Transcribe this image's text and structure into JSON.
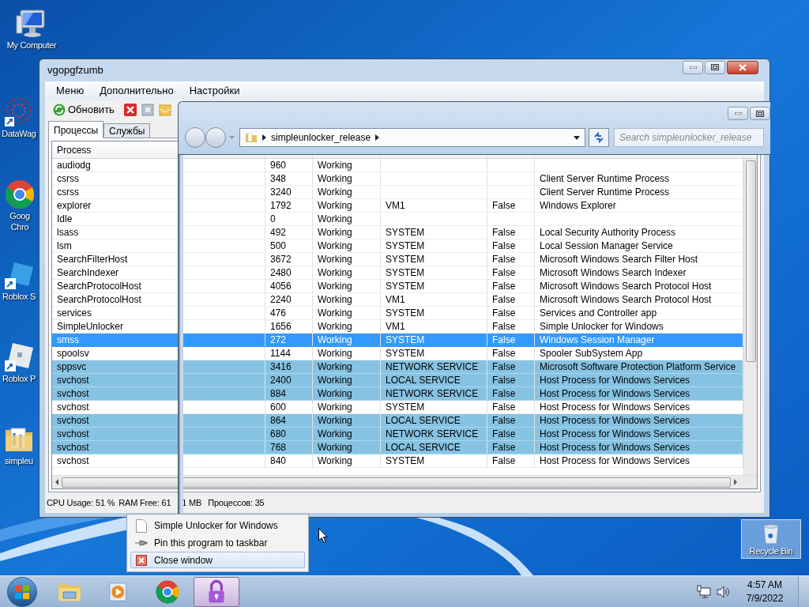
{
  "desktop_icons": [
    {
      "kind": "computer",
      "lines": [
        "My Computer"
      ],
      "selected": false
    },
    {
      "kind": "network",
      "lines": [
        "DataWag"
      ],
      "selected": false
    },
    {
      "kind": "chrome",
      "lines": [
        "Goog",
        "Chro"
      ],
      "selected": false
    },
    {
      "kind": "studio",
      "lines": [
        "Roblox S"
      ],
      "selected": false
    },
    {
      "kind": "roblox",
      "lines": [
        "Roblox P"
      ],
      "selected": false
    },
    {
      "kind": "folder",
      "lines": [
        "simpleu"
      ],
      "selected": false
    }
  ],
  "recycle_bin": {
    "kind": "bin",
    "lines": [
      "Recycle Bin"
    ],
    "selected": true
  },
  "main_window": {
    "title": "vgopgfzumb",
    "menu": [
      "Меню",
      "Дополнительно",
      "Настройки"
    ],
    "toolbar": {
      "refresh": "Обновить"
    },
    "tabs": [
      {
        "label": "Процессы",
        "selected": true
      },
      {
        "label": "Службы",
        "selected": false
      }
    ],
    "table": {
      "columns": [
        "Process"
      ],
      "rows": [
        {
          "process": "audiodg",
          "id": "960",
          "status": "Working",
          "selected": false,
          "highlighted": false
        },
        {
          "process": "csrss",
          "id": "348",
          "status": "Working",
          "description": "Client Server Runtime Process",
          "selected": false,
          "highlighted": false
        },
        {
          "process": "csrss",
          "id": "3240",
          "status": "Working",
          "description": "Client Server Runtime Process",
          "selected": false,
          "highlighted": false
        },
        {
          "process": "explorer",
          "id": "1792",
          "status": "Working",
          "username": "VM1",
          "critical": "False",
          "description": "Windows Explorer",
          "selected": false,
          "highlighted": false
        },
        {
          "process": "Idle",
          "id": "0",
          "status": "Working",
          "selected": false,
          "highlighted": false
        },
        {
          "process": "lsass",
          "id": "492",
          "status": "Working",
          "username": "SYSTEM",
          "critical": "False",
          "description": "Local Security Authority Process",
          "selected": false,
          "highlighted": false
        },
        {
          "process": "lsm",
          "id": "500",
          "status": "Working",
          "username": "SYSTEM",
          "critical": "False",
          "description": "Local Session Manager Service",
          "selected": false,
          "highlighted": false
        },
        {
          "process": "SearchFilterHost",
          "id": "3672",
          "status": "Working",
          "username": "SYSTEM",
          "critical": "False",
          "description": "Microsoft Windows Search Filter Host",
          "selected": false,
          "highlighted": false
        },
        {
          "process": "SearchIndexer",
          "id": "2480",
          "status": "Working",
          "username": "SYSTEM",
          "critical": "False",
          "description": "Microsoft Windows Search Indexer",
          "selected": false,
          "highlighted": false
        },
        {
          "process": "SearchProtocolHost",
          "id": "4056",
          "status": "Working",
          "username": "SYSTEM",
          "critical": "False",
          "description": "Microsoft Windows Search Protocol Host",
          "selected": false,
          "highlighted": false
        },
        {
          "process": "SearchProtocolHost",
          "id": "2240",
          "status": "Working",
          "username": "VM1",
          "critical": "False",
          "description": "Microsoft Windows Search Protocol Host",
          "selected": false,
          "highlighted": false
        },
        {
          "process": "services",
          "id": "476",
          "status": "Working",
          "username": "SYSTEM",
          "critical": "False",
          "description": "Services and Controller app",
          "selected": false,
          "highlighted": false
        },
        {
          "process": "SimpleUnlocker",
          "id": "1656",
          "status": "Working",
          "username": "VM1",
          "critical": "False",
          "description": "Simple Unlocker for Windows",
          "selected": false,
          "highlighted": false
        },
        {
          "process": "smss",
          "id": "272",
          "status": "Working",
          "username": "SYSTEM",
          "critical": "False",
          "description": "Windows Session Manager",
          "selected": true,
          "highlighted": false
        },
        {
          "process": "spoolsv",
          "id": "1144",
          "status": "Working",
          "username": "SYSTEM",
          "critical": "False",
          "description": "Spooler SubSystem App",
          "selected": false,
          "highlighted": false
        },
        {
          "process": "sppsvc",
          "id": "3416",
          "status": "Working",
          "username": "NETWORK SERVICE",
          "critical": "False",
          "description": "Microsoft Software Protection Platform Service",
          "selected": false,
          "highlighted": true
        },
        {
          "process": "svchost",
          "id": "2400",
          "status": "Working",
          "username": "LOCAL SERVICE",
          "critical": "False",
          "description": "Host Process for Windows Services",
          "selected": false,
          "highlighted": true
        },
        {
          "process": "svchost",
          "id": "884",
          "status": "Working",
          "username": "NETWORK SERVICE",
          "critical": "False",
          "description": "Host Process for Windows Services",
          "selected": false,
          "highlighted": true
        },
        {
          "process": "svchost",
          "id": "600",
          "status": "Working",
          "username": "SYSTEM",
          "critical": "False",
          "description": "Host Process for Windows Services",
          "selected": false,
          "highlighted": false
        },
        {
          "process": "svchost",
          "id": "864",
          "status": "Working",
          "username": "LOCAL SERVICE",
          "critical": "False",
          "description": "Host Process for Windows Services",
          "selected": false,
          "highlighted": true
        },
        {
          "process": "svchost",
          "id": "680",
          "status": "Working",
          "username": "NETWORK SERVICE",
          "critical": "False",
          "description": "Host Process for Windows Services",
          "selected": false,
          "highlighted": true
        },
        {
          "process": "svchost",
          "id": "768",
          "status": "Working",
          "username": "LOCAL SERVICE",
          "critical": "False",
          "description": "Host Process for Windows Services",
          "selected": false,
          "highlighted": true
        },
        {
          "process": "svchost",
          "id": "840",
          "status": "Working",
          "username": "SYSTEM",
          "critical": "False",
          "description": "Host Process for Windows Services",
          "selected": false,
          "highlighted": false
        }
      ]
    },
    "status_bar": {
      "cpu": "CPU Usage: 51 %",
      "ram": "RAM Free: 61",
      "ram_rest": "1 MB",
      "count": "Процессов: 35"
    }
  },
  "explorer_window": {
    "address": "simpleunlocker_release",
    "search": {
      "placeholder": "Search simpleunlocker_release"
    }
  },
  "jump_list": [
    {
      "kind": "document",
      "label": "Simple Unlocker for Windows",
      "selected": false
    },
    {
      "kind": "pin",
      "label": "Pin this program to taskbar",
      "selected": false
    },
    {
      "kind": "close",
      "label": "Close window",
      "selected": true
    }
  ],
  "taskbar": {
    "apps": [
      {
        "kind": "explorer",
        "selected": false
      },
      {
        "kind": "media",
        "selected": false
      },
      {
        "kind": "chrome",
        "selected": false
      },
      {
        "kind": "lock",
        "selected": true
      }
    ],
    "clock": {
      "time": "4:57 AM",
      "date": "7/9/2022"
    }
  }
}
